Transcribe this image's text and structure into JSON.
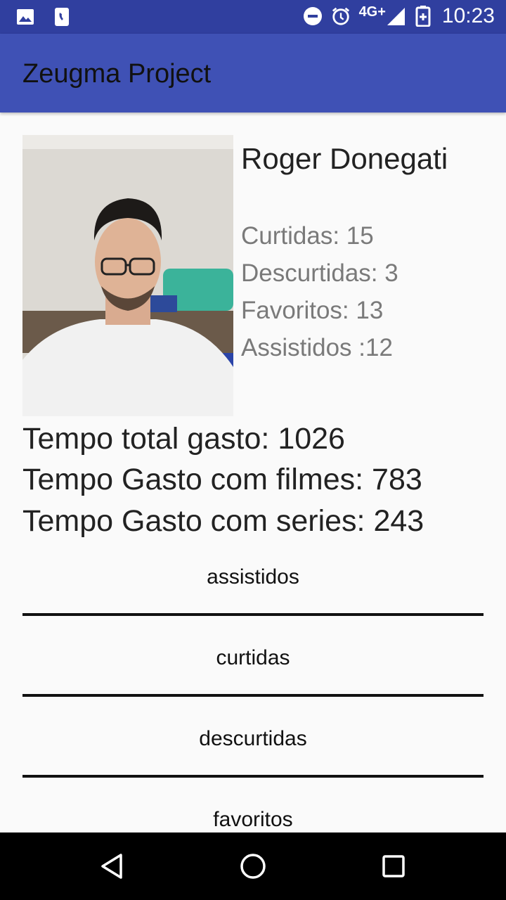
{
  "status_bar": {
    "time": "10:23",
    "network": "4G+",
    "icons": [
      "image-icon",
      "phone-icon",
      "do-not-disturb-icon",
      "alarm-icon",
      "signal-icon",
      "battery-charging-icon"
    ]
  },
  "app_bar": {
    "title": "Zeugma Project"
  },
  "profile": {
    "name": "Roger Donegati",
    "stats": {
      "curtidas": "Curtidas: 15",
      "descurtidas": "Descurtidas: 3",
      "favoritos": "Favoritos: 13",
      "assistidos": "Assistidos :12"
    }
  },
  "time_spent": {
    "total": "Tempo total gasto: 1026",
    "movies": "Tempo Gasto com filmes: 783",
    "series": "Tempo Gasto com series: 243"
  },
  "tabs": [
    {
      "label": "assistidos"
    },
    {
      "label": "curtidas"
    },
    {
      "label": "descurtidas"
    },
    {
      "label": "favoritos"
    }
  ],
  "colors": {
    "status_bar": "#303f9f",
    "app_bar": "#3f51b5",
    "background": "#fafafa",
    "nav_bar": "#000000"
  }
}
